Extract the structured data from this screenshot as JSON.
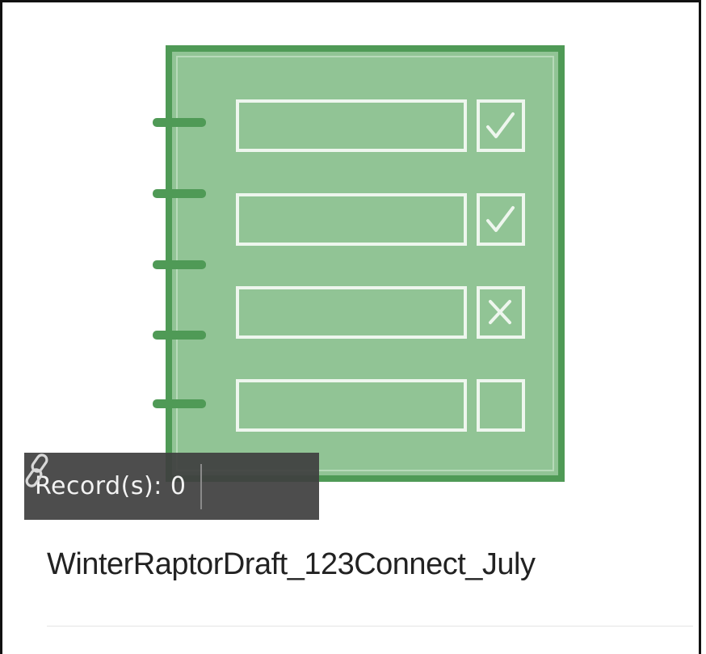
{
  "item": {
    "title": "WinterRaptorDraft_123Connect_July",
    "record_label": "Record(s): 0",
    "thumbnail_icon": "survey-form-icon",
    "link_icon": "link-icon"
  },
  "colors": {
    "thumbnail_fill": "#91c495",
    "thumbnail_border": "#4e9a55",
    "thumbnail_lines": "#eef6ee",
    "overlay_bg": "#404040",
    "overlay_text": "#f2f2f2",
    "title_text": "#222222"
  }
}
